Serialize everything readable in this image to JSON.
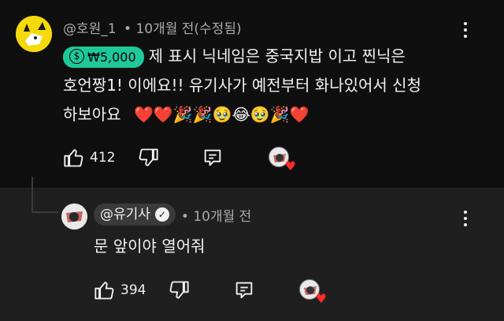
{
  "comment": {
    "author": "@호원_1",
    "meta": "• 10개월 전(수정됨)",
    "superchat_amount": "₩5,000",
    "text_line1": "제 표시 닉네임은 중국지밥 이고 찐닉은",
    "text_line2": "호언짱1! 이에요!! 유기사가 예전부터 화나있어서 신청",
    "text_line3": "하보아요",
    "emoji_line3": "❤️❤️🎉🎉🥹😂🥹🎉❤️",
    "likes": "412",
    "icons": {
      "like": "thumbs-up-icon",
      "dislike": "thumbs-down-icon",
      "reply": "reply-comment-icon",
      "more": "more-vert-icon",
      "creator_heart": "creator-heart-icon"
    }
  },
  "reply": {
    "author": "@유기사",
    "verified": true,
    "meta": "• 10개월 전",
    "text": "문 앞이야 열어줘",
    "likes": "394",
    "icons": {
      "like": "thumbs-up-icon",
      "dislike": "thumbs-down-icon",
      "reply": "reply-comment-icon",
      "more": "more-vert-icon",
      "creator_heart": "creator-heart-icon"
    }
  },
  "colors": {
    "background": "#0f0f0f",
    "reply_background": "#1f1f1f",
    "superchat": "#1ec999",
    "heart": "#ff2b2b"
  }
}
